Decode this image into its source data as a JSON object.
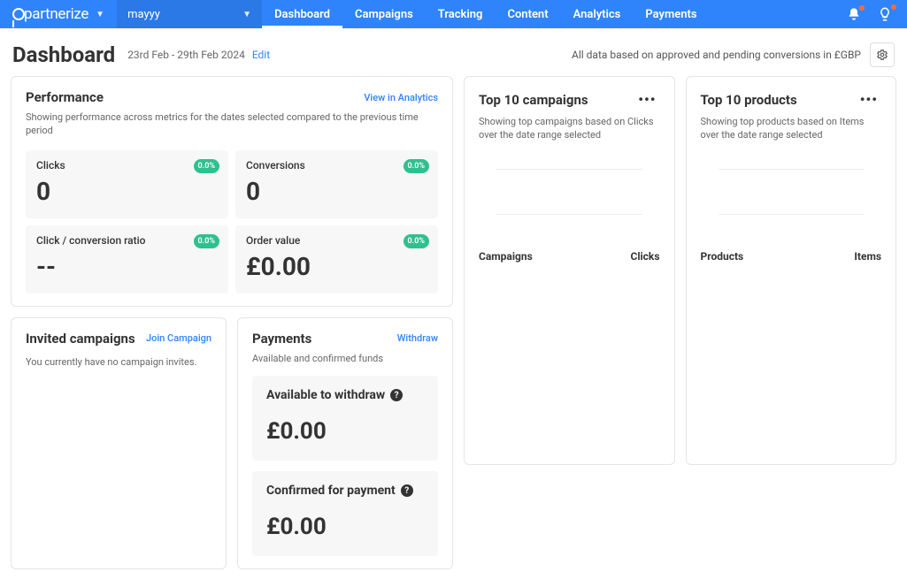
{
  "brand": "partnerize",
  "account": "mayyy",
  "nav": {
    "dashboard": "Dashboard",
    "campaigns": "Campaigns",
    "tracking": "Tracking",
    "content": "Content",
    "analytics": "Analytics",
    "payments": "Payments"
  },
  "header": {
    "title": "Dashboard",
    "date_range": "23rd Feb - 29th Feb 2024",
    "edit": "Edit",
    "note": "All data based on approved and pending conversions in £GBP"
  },
  "performance": {
    "title": "Performance",
    "link": "View in Analytics",
    "subtitle": "Showing performance across metrics for the dates selected compared to the previous time period",
    "metrics": {
      "clicks": {
        "label": "Clicks",
        "value": "0",
        "pct": "0.0%"
      },
      "conversions": {
        "label": "Conversions",
        "value": "0",
        "pct": "0.0%"
      },
      "ratio": {
        "label": "Click / conversion ratio",
        "value": "--",
        "pct": "0.0%"
      },
      "order": {
        "label": "Order value",
        "value": "£0.00",
        "pct": "0.0%"
      }
    }
  },
  "invited": {
    "title": "Invited campaigns",
    "link": "Join Campaign",
    "body": "You currently have no campaign invites."
  },
  "payments_card": {
    "title": "Payments",
    "link": "Withdraw",
    "subtitle": "Available and confirmed funds",
    "available": {
      "label": "Available to withdraw",
      "value": "£0.00"
    },
    "confirmed": {
      "label": "Confirmed for payment",
      "value": "£0.00"
    }
  },
  "top_campaigns": {
    "title": "Top 10 campaigns",
    "subtitle": "Showing top campaigns based on Clicks over the date range selected",
    "col_left": "Campaigns",
    "col_right": "Clicks"
  },
  "top_products": {
    "title": "Top 10 products",
    "subtitle": "Showing top products based on Items over the date range selected",
    "col_left": "Products",
    "col_right": "Items"
  }
}
